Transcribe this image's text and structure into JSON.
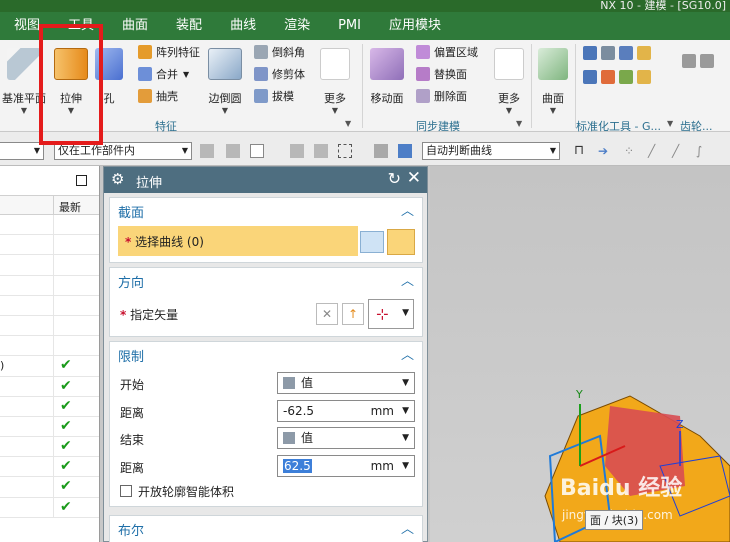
{
  "title_strip": "NX 10 - 建模 - [SG10.0]",
  "tabs": [
    "视图",
    "工具",
    "曲面",
    "装配",
    "曲线",
    "渲染",
    "PMI",
    "应用模块"
  ],
  "ribbon": {
    "datum_plane": "基准平面",
    "extrude": "拉伸",
    "hole": "孔",
    "pattern_feature": "阵列特征",
    "unite": "合并",
    "shell": "抽壳",
    "edge_blend": "边倒圆",
    "chamfer": "倒斜角",
    "trim_body": "修剪体",
    "draft": "拔模",
    "more1": "更多",
    "feature_group": "特征",
    "move_face": "移动面",
    "offset_region": "偏置区域",
    "replace_face": "替换面",
    "delete_face": "删除面",
    "more2": "更多",
    "sync_group": "同步建模",
    "surface": "曲面",
    "std_tools_group": "标准化工具 - G...",
    "gear_group": "齿轮..."
  },
  "toolbar": {
    "scope_combo": "仅在工作部件内",
    "curve_rule_combo": "自动判断曲线"
  },
  "nav": {
    "col_latest": "最新",
    "row_fragment": ")",
    "checks": 8
  },
  "dialog": {
    "title": "拉伸",
    "section": {
      "header": "截面",
      "select_curve": "选择曲线 (0)"
    },
    "direction": {
      "header": "方向",
      "specify_vector": "指定矢量"
    },
    "limits": {
      "header": "限制",
      "start_label": "开始",
      "start_value": "值",
      "distance1_label": "距离",
      "distance1_value": "-62.5",
      "distance1_unit": "mm",
      "end_label": "结束",
      "end_value": "值",
      "distance2_label": "距离",
      "distance2_value": "62.5",
      "distance2_unit": "mm",
      "open_profile": "开放轮廓智能体积"
    },
    "boolean": {
      "header": "布尔"
    }
  },
  "viewport": {
    "axis_y": "Y",
    "axis_z": "Z",
    "face_label": "面 / 块(3)",
    "watermark": "Baidu 经验",
    "watermark_sub": "jingyan.baidu.com"
  },
  "colors": {
    "tab_bar": "#2f7a3a",
    "dialog_title": "#4e6e80",
    "section_header": "#1f6fa8",
    "highlight": "#e41b1b",
    "selection_row": "#fad579",
    "part": "#f2a81a"
  }
}
